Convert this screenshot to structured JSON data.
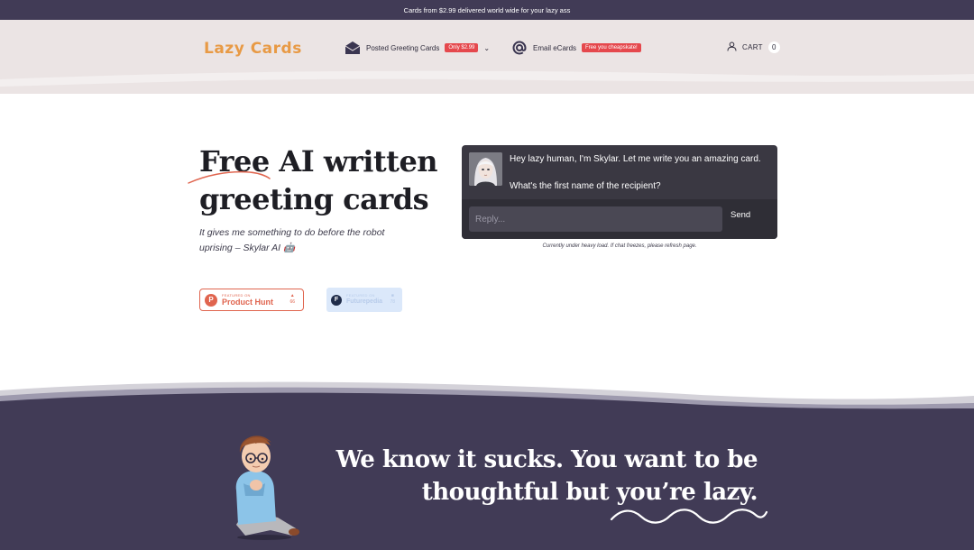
{
  "announcement": {
    "text": "Cards from $2.99 delivered world wide for your lazy ass"
  },
  "header": {
    "logo": "Lazy Cards",
    "nav": [
      {
        "label": "Posted Greeting Cards",
        "badge": "Only $2.99",
        "icon": "envelope-icon",
        "has_dropdown": true
      },
      {
        "label": "Email eCards",
        "badge": "Free you cheapskate!",
        "icon": "at-sign-icon"
      }
    ],
    "cart": {
      "label": "CART",
      "count": "0",
      "icon": "user-icon"
    }
  },
  "hero": {
    "title_line1": "Free AI written",
    "title_line2": "greeting cards",
    "subtitle": "It gives me something to do before the robot uprising – Skylar AI 🤖"
  },
  "badges": {
    "product_hunt": {
      "small": "FEATURED ON",
      "big": "Product Hunt",
      "votes": "66"
    },
    "futurepedia": {
      "small": "FEATURED ON",
      "big": "Futurepedia",
      "votes": "78"
    }
  },
  "chat": {
    "message1": "Hey lazy human, I'm Skylar. Let me write you an amazing card.",
    "message2": "What's the first name of the recipient?",
    "input_placeholder": "Reply...",
    "send_label": "Send",
    "note": "Currently under heavy load. If chat freezes, please refresh page."
  },
  "tagline": {
    "line1": "We know it sucks. You want to be",
    "line2": "thoughtful but you’re lazy."
  },
  "colors": {
    "brand_orange": "#e89a45",
    "dark_purple": "#413b56",
    "header_bg": "#ebe4e4",
    "badge_red": "#e5484d",
    "chat_bg": "#3a3842"
  }
}
